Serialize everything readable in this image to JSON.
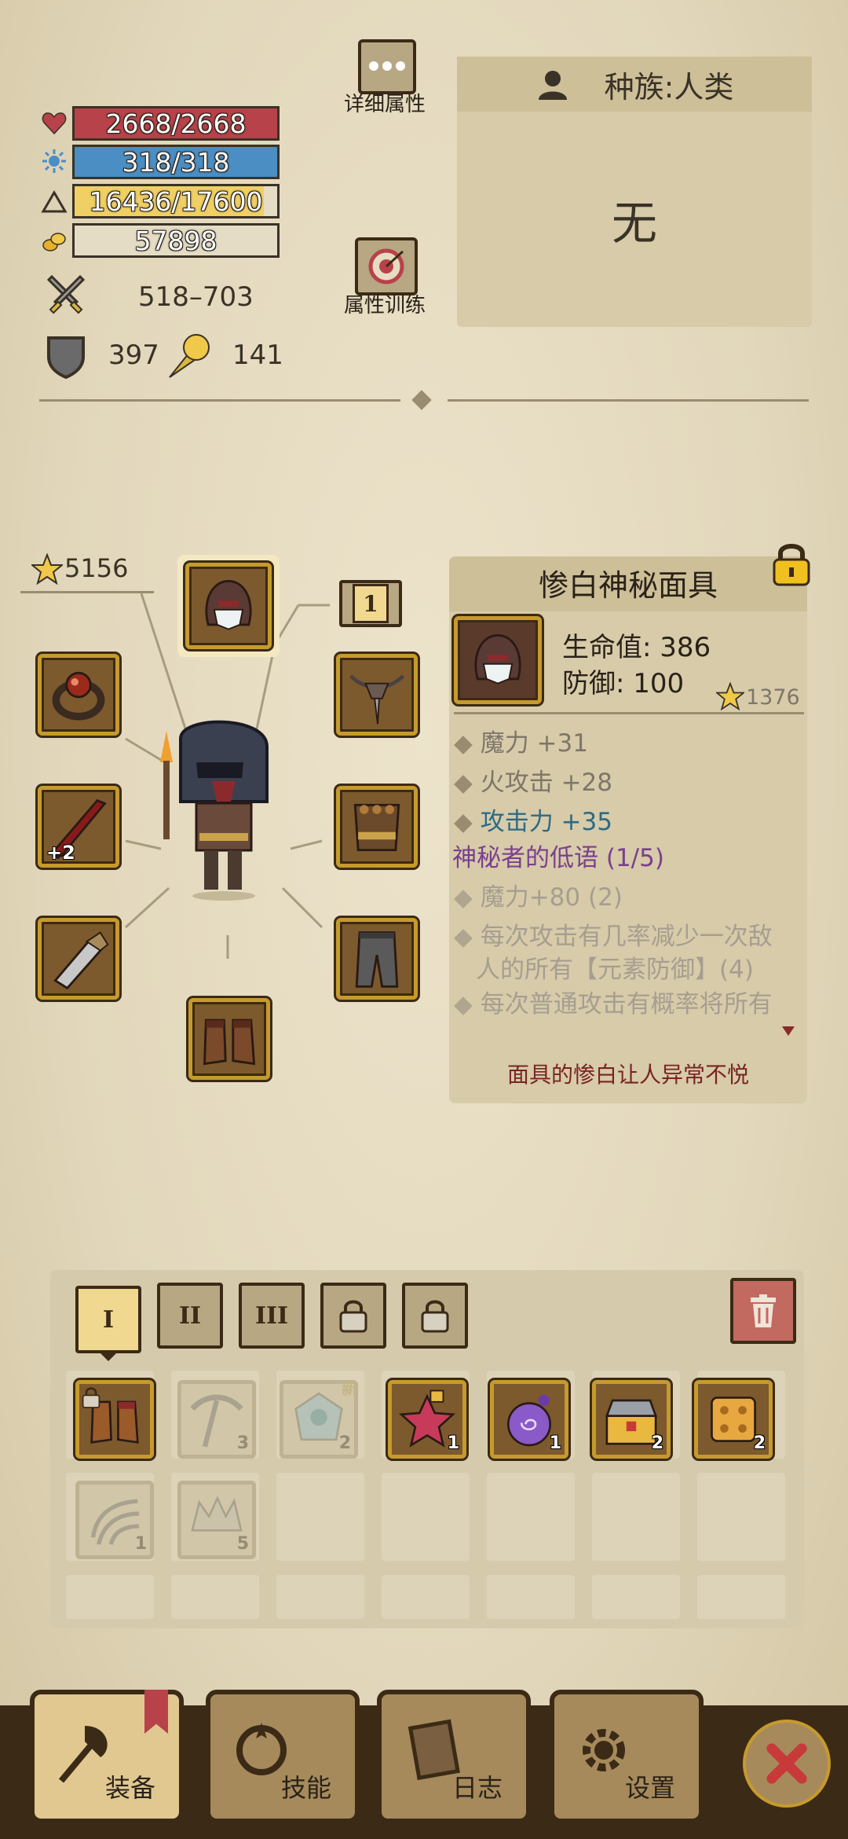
{
  "stats": {
    "hp": "2668/2668",
    "mp": "318/318",
    "exp": "16436/17600",
    "exp_fill": 0.934,
    "gold": "57898",
    "attack": "518–703",
    "defense": "397",
    "other": "141"
  },
  "buttons": {
    "detail_attr": "详细属性",
    "attr_train": "属性训练"
  },
  "race": {
    "label": "种族:人类",
    "value": "无"
  },
  "equip": {
    "score": "5156",
    "slot_count": "1",
    "weapon_level": "+2"
  },
  "item_detail": {
    "name": "惨白神秘面具",
    "hp": "生命值: 386",
    "defense": "防御: 100",
    "score": "1376",
    "affixes": [
      "魔力 +31",
      "火攻击 +28",
      "攻击力 +35"
    ],
    "set_name": "神秘者的低语 (1/5)",
    "set_bonus": [
      "魔力+80 (2)",
      "每次攻击有几率减少一次敌",
      "人的所有【元素防御】(4)",
      "每次普通攻击有概率将所有"
    ],
    "flavor": "面具的惨白让人异常不悦"
  },
  "bag_tabs": [
    "I",
    "II",
    "III"
  ],
  "inventory": {
    "counts": [
      "3",
      "2",
      "1",
      "1",
      "2",
      "2",
      "1",
      "5"
    ],
    "new_badge": "新"
  },
  "nav": {
    "equip": "装备",
    "skill": "技能",
    "log": "日志",
    "settings": "设置"
  },
  "colors": {
    "hp": "#b8424a",
    "mp": "#4a8ec4",
    "exp": "#f0d064",
    "gold_bar": "#e4dcc4",
    "affix_blue": "#2e6a84",
    "set_purple": "#7a3f8e",
    "slot_gold": "#c69a2c"
  }
}
